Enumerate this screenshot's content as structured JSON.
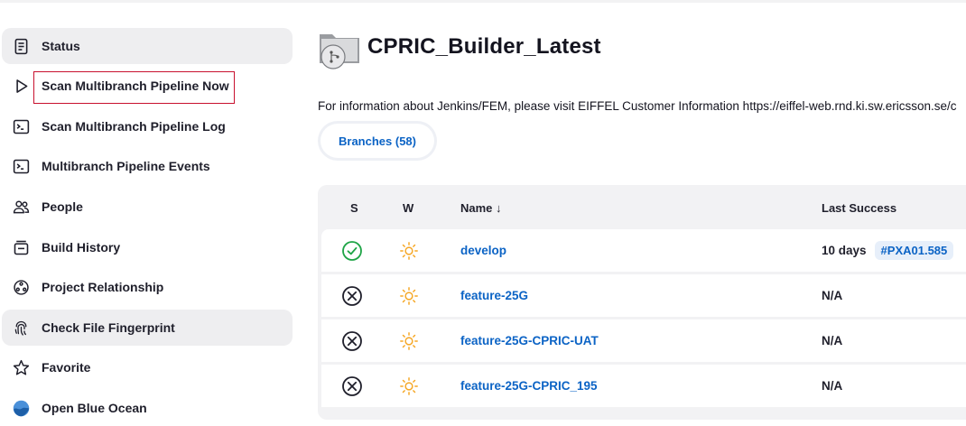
{
  "sidebar": {
    "items": [
      {
        "label": "Status",
        "icon": "document-icon"
      },
      {
        "label": "Scan Multibranch Pipeline Now",
        "icon": "play-icon"
      },
      {
        "label": "Scan Multibranch Pipeline Log",
        "icon": "terminal-icon"
      },
      {
        "label": "Multibranch Pipeline Events",
        "icon": "terminal-icon"
      },
      {
        "label": "People",
        "icon": "people-icon"
      },
      {
        "label": "Build History",
        "icon": "build-history-icon"
      },
      {
        "label": "Project Relationship",
        "icon": "relationship-icon"
      },
      {
        "label": "Check File Fingerprint",
        "icon": "fingerprint-icon"
      },
      {
        "label": "Favorite",
        "icon": "star-icon"
      },
      {
        "label": "Open Blue Ocean",
        "icon": "blue-ocean-icon"
      }
    ]
  },
  "header": {
    "title": "CPRIC_Builder_Latest",
    "info": "For information about Jenkins/FEM, please visit EIFFEL Customer Information https://eiffel-web.rnd.ki.sw.ericsson.se/c"
  },
  "tabs": [
    {
      "label": "Branches (58)"
    }
  ],
  "table": {
    "headers": {
      "s": "S",
      "w": "W",
      "name": "Name ↓",
      "last_success": "Last Success"
    },
    "rows": [
      {
        "status": "success",
        "weather": "sunny",
        "name": "develop",
        "last_success": "10 days",
        "build": "#PXA01.585"
      },
      {
        "status": "not-built",
        "weather": "sunny",
        "name": "feature-25G",
        "last_success": "N/A",
        "build": ""
      },
      {
        "status": "not-built",
        "weather": "sunny",
        "name": "feature-25G-CPRIC-UAT",
        "last_success": "N/A",
        "build": ""
      },
      {
        "status": "not-built",
        "weather": "sunny",
        "name": "feature-25G-CPRIC_195",
        "last_success": "N/A",
        "build": ""
      }
    ]
  },
  "colors": {
    "link": "#0b63c5",
    "success": "#1ea446",
    "sun": "#f5a623",
    "highlight": "#c8102e"
  }
}
